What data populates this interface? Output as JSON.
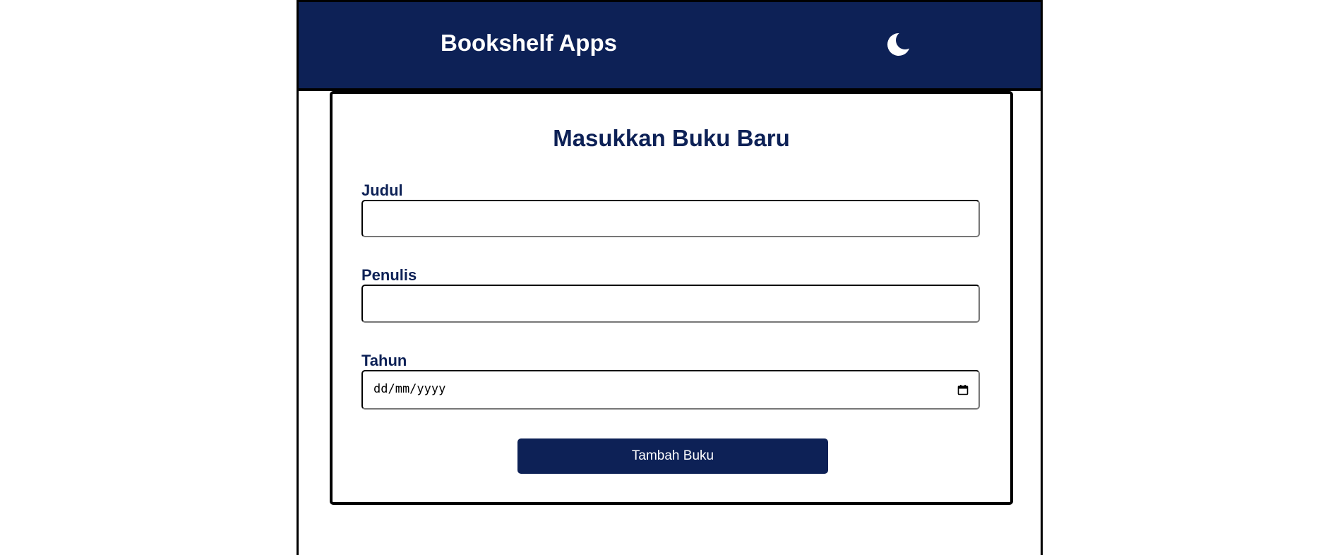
{
  "header": {
    "title": "Bookshelf Apps",
    "theme_icon": "moon-icon"
  },
  "form": {
    "title": "Masukkan Buku Baru",
    "fields": [
      {
        "label": "Judul",
        "value": "",
        "placeholder": ""
      },
      {
        "label": "Penulis",
        "value": "",
        "placeholder": ""
      },
      {
        "label": "Tahun",
        "value": "",
        "placeholder": "dd/mm/yyyy",
        "icon": "calendar-icon"
      }
    ],
    "submit_label": "Tambah Buku"
  },
  "colors": {
    "primary": "#0d2156",
    "background": "#ffffff",
    "border": "#000000",
    "text_on_primary": "#ffffff"
  }
}
